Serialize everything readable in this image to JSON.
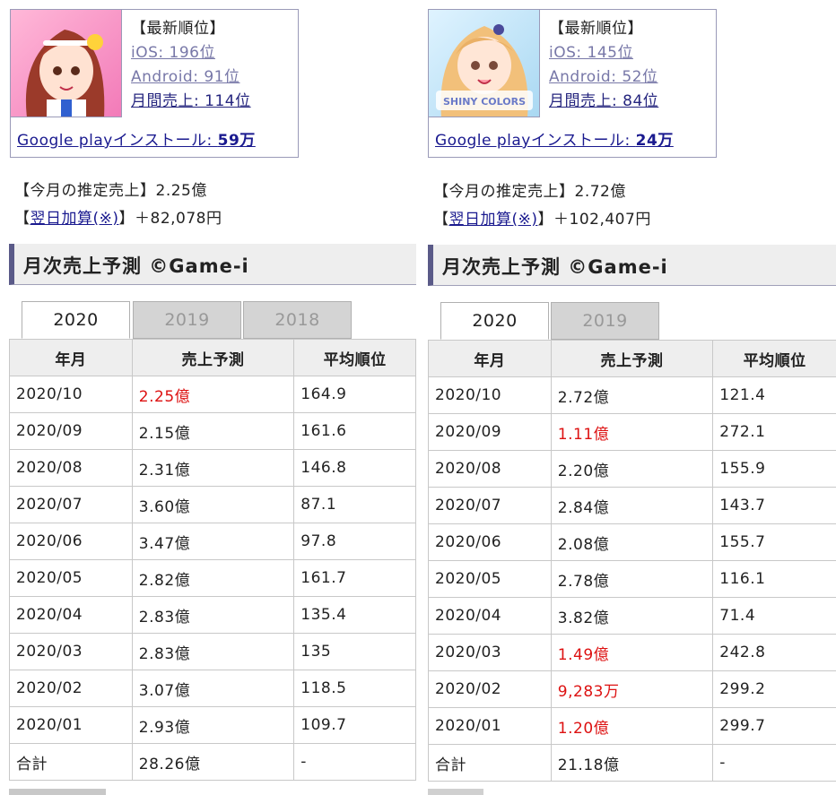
{
  "left": {
    "ranks": {
      "header": "【最新順位】",
      "ios": "iOS: 196位",
      "android": "Android: 91位",
      "monthly": "月間売上: 114位"
    },
    "google_play_label": "Google playインストール: ",
    "google_play_value": "59万",
    "est_sales_label": "【今月の推定売上】",
    "est_sales_value": "2.25億",
    "next_day_prefix": "【",
    "next_day_link": "翌日加算(※)",
    "next_day_suffix": "】＋82,078円",
    "heading": "月次売上予測 ©Game-i",
    "tabs": [
      "2020",
      "2019",
      "2018"
    ],
    "columns": [
      "年月",
      "売上予測",
      "平均順位"
    ],
    "rows": [
      {
        "month": "2020/10",
        "sales": "2.25億",
        "rank": "164.9",
        "red": true
      },
      {
        "month": "2020/09",
        "sales": "2.15億",
        "rank": "161.6",
        "red": false
      },
      {
        "month": "2020/08",
        "sales": "2.31億",
        "rank": "146.8",
        "red": false
      },
      {
        "month": "2020/07",
        "sales": "3.60億",
        "rank": "87.1",
        "red": false
      },
      {
        "month": "2020/06",
        "sales": "3.47億",
        "rank": "97.8",
        "red": false
      },
      {
        "month": "2020/05",
        "sales": "2.82億",
        "rank": "161.7",
        "red": false
      },
      {
        "month": "2020/04",
        "sales": "2.83億",
        "rank": "135.4",
        "red": false
      },
      {
        "month": "2020/03",
        "sales": "2.83億",
        "rank": "135",
        "red": false
      },
      {
        "month": "2020/02",
        "sales": "3.07億",
        "rank": "118.5",
        "red": false
      },
      {
        "month": "2020/01",
        "sales": "2.93億",
        "rank": "109.7",
        "red": false
      }
    ],
    "total": {
      "label": "合計",
      "sales": "28.26億",
      "rank": "-"
    }
  },
  "right": {
    "ranks": {
      "header": "【最新順位】",
      "ios": "iOS: 145位",
      "android": "Android: 52位",
      "monthly": "月間売上: 84位"
    },
    "google_play_label": "Google playインストール: ",
    "google_play_value": "24万",
    "est_sales_label": "【今月の推定売上】",
    "est_sales_value": "2.72億",
    "next_day_prefix": "【",
    "next_day_link": "翌日加算(※)",
    "next_day_suffix": "】＋102,407円",
    "heading": "月次売上予測 ©Game-i",
    "tabs": [
      "2020",
      "2019"
    ],
    "columns": [
      "年月",
      "売上予測",
      "平均順位"
    ],
    "rows": [
      {
        "month": "2020/10",
        "sales": "2.72億",
        "rank": "121.4",
        "red": false
      },
      {
        "month": "2020/09",
        "sales": "1.11億",
        "rank": "272.1",
        "red": true
      },
      {
        "month": "2020/08",
        "sales": "2.20億",
        "rank": "155.9",
        "red": false
      },
      {
        "month": "2020/07",
        "sales": "2.84億",
        "rank": "143.7",
        "red": false
      },
      {
        "month": "2020/06",
        "sales": "2.08億",
        "rank": "155.7",
        "red": false
      },
      {
        "month": "2020/05",
        "sales": "2.78億",
        "rank": "116.1",
        "red": false
      },
      {
        "month": "2020/04",
        "sales": "3.82億",
        "rank": "71.4",
        "red": false
      },
      {
        "month": "2020/03",
        "sales": "1.49億",
        "rank": "242.8",
        "red": true
      },
      {
        "month": "2020/02",
        "sales": "9,283万",
        "rank": "299.2",
        "red": true
      },
      {
        "month": "2020/01",
        "sales": "1.20億",
        "rank": "299.7",
        "red": true
      }
    ],
    "total": {
      "label": "合計",
      "sales": "21.18億",
      "rank": "-"
    }
  },
  "colors": {
    "accent": "#5a5a88",
    "link": "#1a1a8f",
    "muted_link": "#7878a8",
    "alert": "#dd1111"
  }
}
